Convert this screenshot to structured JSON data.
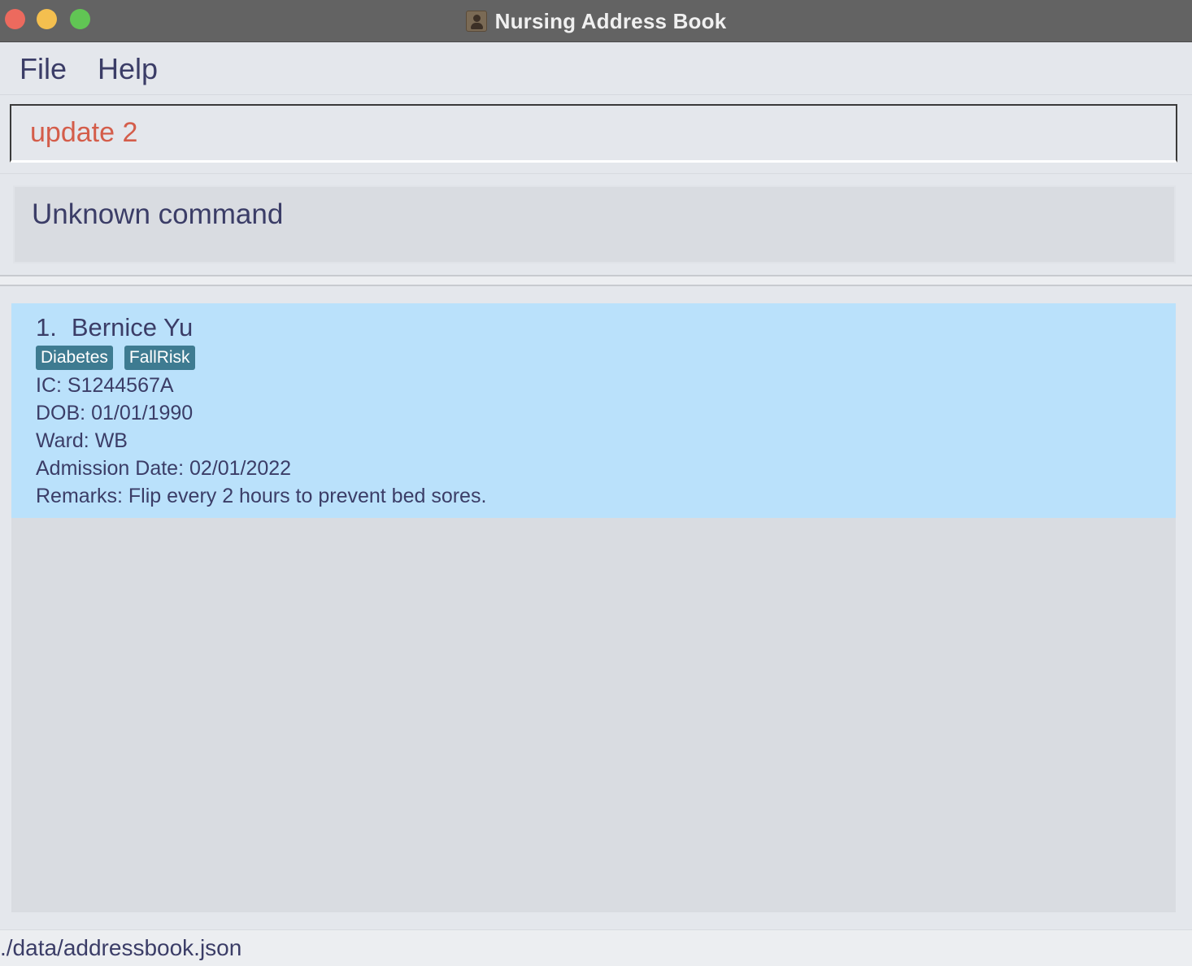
{
  "window": {
    "title": "Nursing Address Book"
  },
  "menu": {
    "file": "File",
    "help": "Help"
  },
  "command": {
    "value": "update 2"
  },
  "result": {
    "message": "Unknown command"
  },
  "patients": [
    {
      "index": "1.",
      "name": "Bernice Yu",
      "tags": [
        "Diabetes",
        "FallRisk"
      ],
      "ic": "IC: S1244567A",
      "dob": "DOB: 01/01/1990",
      "ward": "Ward: WB",
      "admission": "Admission Date: 02/01/2022",
      "remarks": "Remarks: Flip every 2 hours to prevent bed sores."
    }
  ],
  "status": {
    "path": "./data/addressbook.json"
  },
  "colors": {
    "titlebar": "#636363",
    "card_selected": "#bae1fb",
    "tag": "#3e7b91",
    "command_text": "#d45d4a",
    "text": "#3b3d67"
  },
  "icons": {
    "app": "address-book-icon"
  }
}
